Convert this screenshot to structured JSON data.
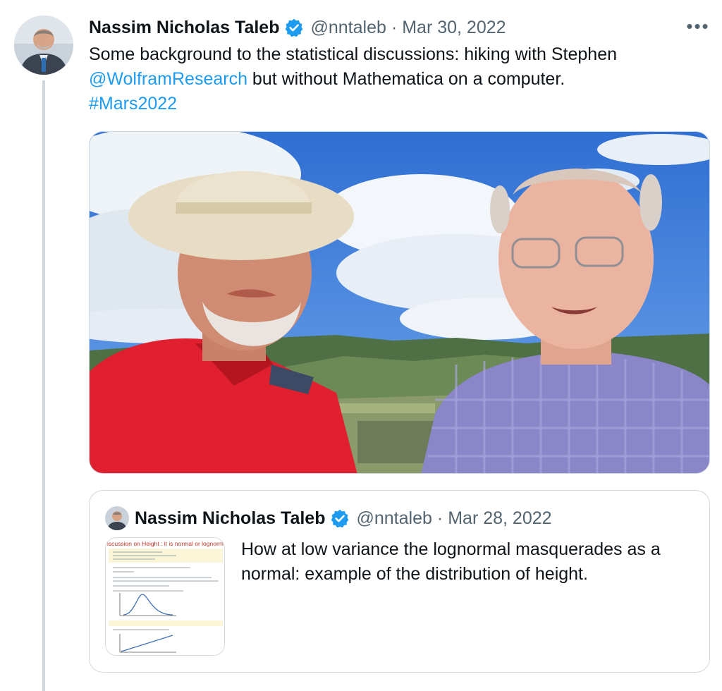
{
  "tweet": {
    "author_name": "Nassim Nicholas Taleb",
    "handle": "@nntaleb",
    "separator": "·",
    "date": "Mar 30, 2022",
    "more_label": "•••",
    "text_part1": "Some background to the statistical discussions: hiking with Stephen ",
    "mention": "@WolframResearch",
    "text_part2": " but without Mathematica on a computer.",
    "hashtag": "#Mars2022"
  },
  "quote": {
    "author_name": "Nassim Nicholas Taleb",
    "handle": "@nntaleb",
    "separator": "·",
    "date": "Mar 28, 2022",
    "text": "How at low variance the lognormal masquerades as a normal: example of the distribution of height.",
    "thumb_title": "iscussion on Height : it is normal or lognormal?"
  },
  "colors": {
    "link": "#1d9bf0",
    "verified": "#1d9bf0",
    "text": "#0f1419",
    "secondary": "#536471",
    "border": "#cfd9de"
  },
  "icons": {
    "verified": "verified-badge-icon",
    "more": "more-options-icon"
  }
}
